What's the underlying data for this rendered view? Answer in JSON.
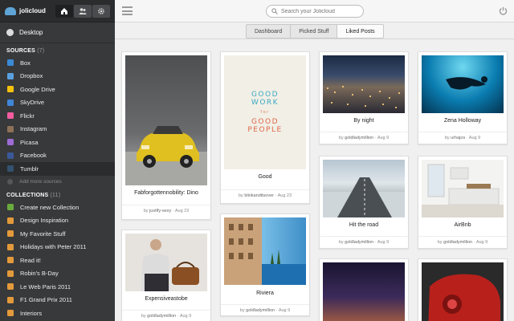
{
  "app": {
    "name": "jolicloud"
  },
  "sidebar": {
    "desktop": "Desktop",
    "sources_title": "SOURCES",
    "sources_count": "(7)",
    "sources": [
      {
        "label": "Box",
        "color": "#3a8ad6",
        "icon": "box-icon"
      },
      {
        "label": "Dropbox",
        "color": "#5aa0e0",
        "icon": "dropbox-icon"
      },
      {
        "label": "Google Drive",
        "color": "#f4c20d",
        "icon": "google-drive-icon"
      },
      {
        "label": "SkyDrive",
        "color": "#3f85d8",
        "icon": "skydrive-icon"
      },
      {
        "label": "Flickr",
        "color": "#f35ca0",
        "icon": "flickr-icon"
      },
      {
        "label": "Instagram",
        "color": "#8d7158",
        "icon": "instagram-icon"
      },
      {
        "label": "Picasa",
        "color": "#9e6cd4",
        "icon": "picasa-icon"
      },
      {
        "label": "Facebook",
        "color": "#3b5998",
        "icon": "facebook-icon"
      },
      {
        "label": "Tumblr",
        "color": "#34526f",
        "icon": "tumblr-icon"
      }
    ],
    "add_more": "Add more sources",
    "collections_title": "COLLECTIONS",
    "collections_count": "(11)",
    "collections": [
      "Create new Collection",
      "Design Inspiration",
      "My Favorite Stuff",
      "Holidays with Peter 2011",
      "Read it!",
      "Robin's B-Day",
      "Le Web Paris 2011",
      "F1 Grand Prix 2011",
      "Interiors"
    ]
  },
  "search": {
    "placeholder": "Search your Jolicloud"
  },
  "tabs": [
    "Dashboard",
    "Picked Stuff",
    "Liked Posts"
  ],
  "active_tab": "Liked Posts",
  "cards": [
    {
      "title": "Fabforgottennobility: Dino",
      "user": "justlfy-sexy",
      "date": "Aug 23"
    },
    {
      "title": "Good",
      "user": "blinkanditsover",
      "date": "Aug 23",
      "poster": [
        "GOOD",
        "WORK",
        "for",
        "GOOD",
        "PEOPLE"
      ]
    },
    {
      "title": "By night",
      "user": "goldladymillion",
      "date": "Aug 9"
    },
    {
      "title": "Zena Holloway",
      "user": "urhajos",
      "date": "Aug 9"
    },
    {
      "title": "Expensiveastobe",
      "user": "goldladymillion",
      "date": "Aug 9"
    },
    {
      "title": "Riviera",
      "user": "goldladymillion",
      "date": "Aug 9"
    },
    {
      "title": "Hit the road",
      "user": "goldladymillion",
      "date": "Aug 9"
    },
    {
      "title": "AirBnb",
      "user": "goldladymillion",
      "date": "Aug 9"
    },
    {
      "title": "",
      "user": "",
      "date": ""
    },
    {
      "title": "",
      "user": "",
      "date": ""
    }
  ],
  "by_label": "by"
}
